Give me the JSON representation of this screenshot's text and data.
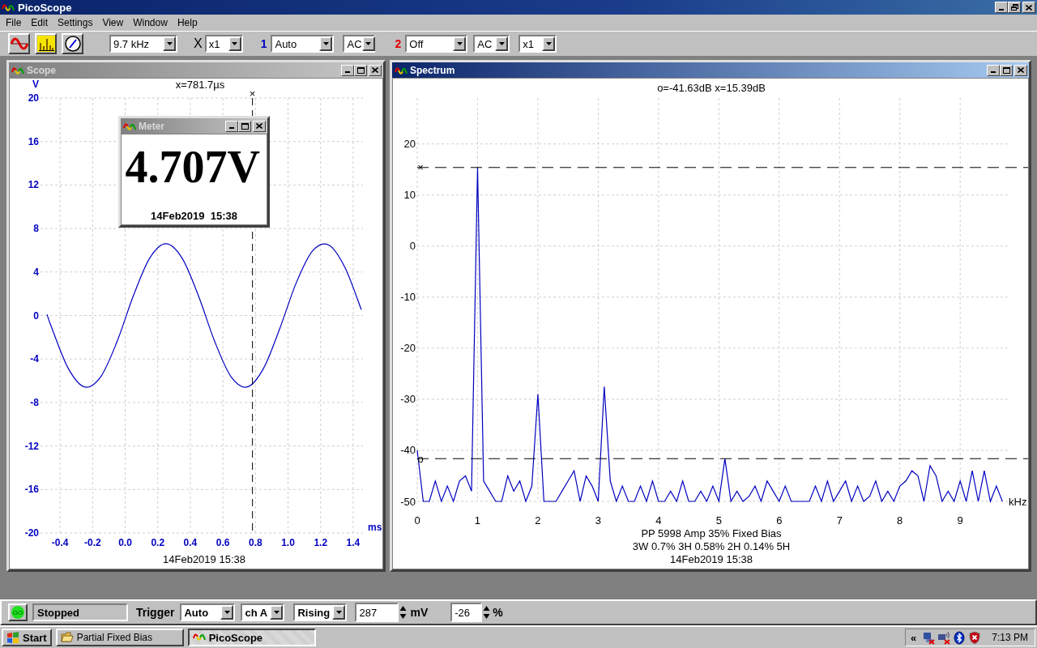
{
  "window": {
    "title": "PicoScope"
  },
  "menu": [
    "File",
    "Edit",
    "Settings",
    "View",
    "Window",
    "Help"
  ],
  "toolbar": {
    "view_buttons": [
      {
        "kind": "scope"
      },
      {
        "kind": "spectrum"
      },
      {
        "kind": "meter"
      }
    ],
    "timebase": "9.7 kHz",
    "multiplier_label": "X",
    "multiplier": "x1",
    "channels": [
      {
        "number": "1",
        "color": "#0000c0",
        "range": "Auto",
        "coupling": "AC"
      },
      {
        "number": "2",
        "color": "#e00000",
        "range": "Off",
        "coupling": "AC",
        "multiplier": "x1"
      }
    ]
  },
  "windows": [
    {
      "kind": "scope",
      "title": "Scope",
      "active": false,
      "readout": "x=781.7µs",
      "footer": [
        "14Feb2019  15:38"
      ],
      "chart_data": {
        "type": "line",
        "xlabel": "ms",
        "ylabel": "V",
        "xlim": [
          -0.52,
          1.46
        ],
        "ylim": [
          -20,
          20
        ],
        "xticks": [
          -0.4,
          -0.2,
          {
            "value": 0,
            "label": "0.0"
          },
          0.2,
          0.4,
          0.6,
          0.8,
          {
            "value": 1,
            "label": "1.0"
          },
          1.2,
          1.4
        ],
        "yticks": [
          -20,
          -16,
          -12,
          -8,
          -4,
          0,
          4,
          8,
          12,
          16,
          20
        ],
        "x": [
          -0.48,
          -0.45,
          -0.35,
          -0.25,
          -0.15,
          -0.05,
          0.05,
          0.15,
          0.25,
          0.35,
          0.45,
          0.55,
          0.65,
          0.75,
          0.85,
          0.95,
          1.05,
          1.15,
          1.25,
          1.35,
          1.45
        ],
        "series": [
          {
            "color": "#0000c0",
            "values": [
              0.1,
              -1.17,
              -4.85,
              -6.57,
              -5.63,
              -2.4,
              1.8,
              5.26,
              6.6,
              5.26,
              1.8,
              -2.4,
              -5.63,
              -6.57,
              -4.85,
              -1.17,
              2.99,
              5.93,
              6.48,
              4.4,
              0.53
            ]
          }
        ],
        "grid": true,
        "ref_lines": [
          {
            "axis": "x",
            "value": 0.7817,
            "label": "×"
          }
        ]
      }
    },
    {
      "kind": "spectrum",
      "title": "Spectrum",
      "active": true,
      "readout": "o=-41.63dB  x=15.39dB",
      "footer": [
        "PP 5998 Amp 35% Fixed Bias",
        "3W 0.7% 3H 0.58% 2H 0.14% 5H",
        "14Feb2019  15:38"
      ],
      "chart_data": {
        "type": "line",
        "xlabel": "kHz",
        "xlim": [
          0,
          9.79
        ],
        "ylim": [
          -50,
          29
        ],
        "grid": true,
        "xticks": [
          0,
          1,
          2,
          3,
          4,
          5,
          6,
          7,
          8,
          9
        ],
        "yticks": [
          -50,
          -40,
          -30,
          -20,
          -10,
          0,
          10,
          20
        ],
        "x": [
          0,
          0.1,
          0.2,
          0.3,
          0.4,
          0.5,
          0.6,
          0.7,
          0.8,
          0.9,
          1,
          1.1,
          1.2,
          1.3,
          1.4,
          1.5,
          1.6,
          1.7,
          1.8,
          1.9,
          2,
          2.1,
          2.2,
          2.3,
          2.4,
          2.5,
          2.6,
          2.7,
          2.8,
          2.9,
          3,
          3.1,
          3.2,
          3.3,
          3.4,
          3.5,
          3.6,
          3.7,
          3.8,
          3.9,
          4,
          4.1,
          4.2,
          4.3,
          4.4,
          4.5,
          4.6,
          4.7,
          4.8,
          4.9,
          5,
          5.1,
          5.2,
          5.3,
          5.4,
          5.5,
          5.6,
          5.7,
          5.8,
          5.9,
          6,
          6.1,
          6.2,
          6.3,
          6.4,
          6.5,
          6.6,
          6.7,
          6.8,
          6.9,
          7,
          7.1,
          7.2,
          7.3,
          7.4,
          7.5,
          7.6,
          7.7,
          7.8,
          7.9,
          8,
          8.1,
          8.2,
          8.3,
          8.4,
          8.5,
          8.6,
          8.7,
          8.8,
          8.9,
          9,
          9.1,
          9.2,
          9.3,
          9.4,
          9.5,
          9.6,
          9.7
        ],
        "series": [
          {
            "color": "#0000c0",
            "values": [
              -40,
              -50,
              -50,
              -46,
              -50,
              -47,
              -50,
              -46,
              -45,
              -48,
              15.4,
              -46,
              -48,
              -50,
              -50,
              -45,
              -48,
              -46,
              -50,
              -47,
              -29,
              -50,
              -50,
              -50,
              -48,
              -46,
              -44,
              -50,
              -45,
              -47,
              -50,
              -27.5,
              -46,
              -50,
              -47,
              -50,
              -50,
              -47,
              -50,
              -46,
              -50,
              -50,
              -48,
              -50,
              -46,
              -50,
              -50,
              -48,
              -50,
              -47,
              -50,
              -41.6,
              -50,
              -48,
              -50,
              -49,
              -47,
              -50,
              -46,
              -48,
              -50,
              -47,
              -50,
              -50,
              -50,
              -50,
              -47,
              -50,
              -46,
              -50,
              -48,
              -46,
              -50,
              -47,
              -50,
              -49,
              -46,
              -50,
              -48,
              -50,
              -47,
              -46,
              -44,
              -45,
              -50,
              -43,
              -45,
              -50,
              -48,
              -50,
              -46,
              -50,
              -44,
              -50,
              -44,
              -50,
              -47,
              -50
            ]
          }
        ],
        "ref_lines": [
          {
            "axis": "y",
            "value": 15.39,
            "label": "×"
          },
          {
            "axis": "y",
            "value": -41.63,
            "label": "o"
          }
        ]
      }
    }
  ],
  "meter": {
    "title": "Meter",
    "active": false,
    "reading": "4.707V",
    "timestamp": "14Feb2019  15:38"
  },
  "status_bar": {
    "go_button": "GO",
    "state": "Stopped",
    "trigger_label": "Trigger",
    "trigger_mode": "Auto",
    "trigger_channel": "ch A",
    "trigger_edge": "Rising",
    "threshold": "287",
    "threshold_unit": "mV",
    "delay": "-26",
    "delay_unit": "%"
  },
  "taskbar": {
    "start": "Start",
    "tasks": [
      {
        "label": "Partial Fixed Bias",
        "kind": "folder",
        "selected": false
      },
      {
        "label": "PicoScope",
        "kind": "app",
        "selected": true
      }
    ],
    "tray_expander": "«",
    "tray_icons": [
      {
        "kind": "network-error"
      },
      {
        "kind": "wireless-error"
      },
      {
        "kind": "bluetooth"
      },
      {
        "kind": "shield"
      }
    ],
    "clock": "7:13 PM"
  }
}
